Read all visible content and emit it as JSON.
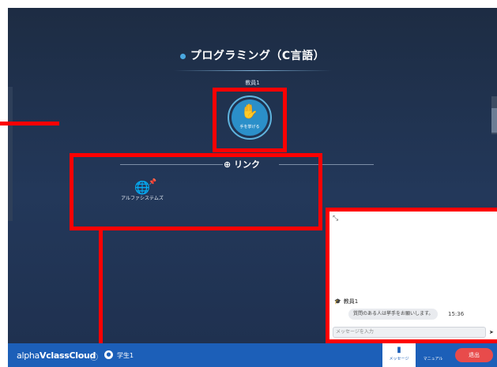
{
  "course": {
    "title": "プログラミング（C言語）",
    "teacher": "教員1"
  },
  "raise_hand": {
    "label": "手を挙げる",
    "icon": "hand-icon"
  },
  "links": {
    "header": "リンク",
    "items": [
      {
        "label": "アルファシステムズ"
      }
    ]
  },
  "chat": {
    "messages": [
      {
        "sender": "教員1",
        "text": "質問のある人は挙手をお願いします。",
        "time": "15:36"
      }
    ],
    "input_placeholder": "メッセージを入力"
  },
  "bottom_bar": {
    "brand_prefix": "alpha",
    "brand_suffix": "VclassCloud",
    "user_name": "学生1",
    "message_tab": "メッセージ",
    "manual_tab": "マニュアル",
    "exit_label": "退出"
  },
  "colors": {
    "accent": "#1c5fb8",
    "exit": "#e84b4b",
    "highlight": "#ff0000"
  }
}
